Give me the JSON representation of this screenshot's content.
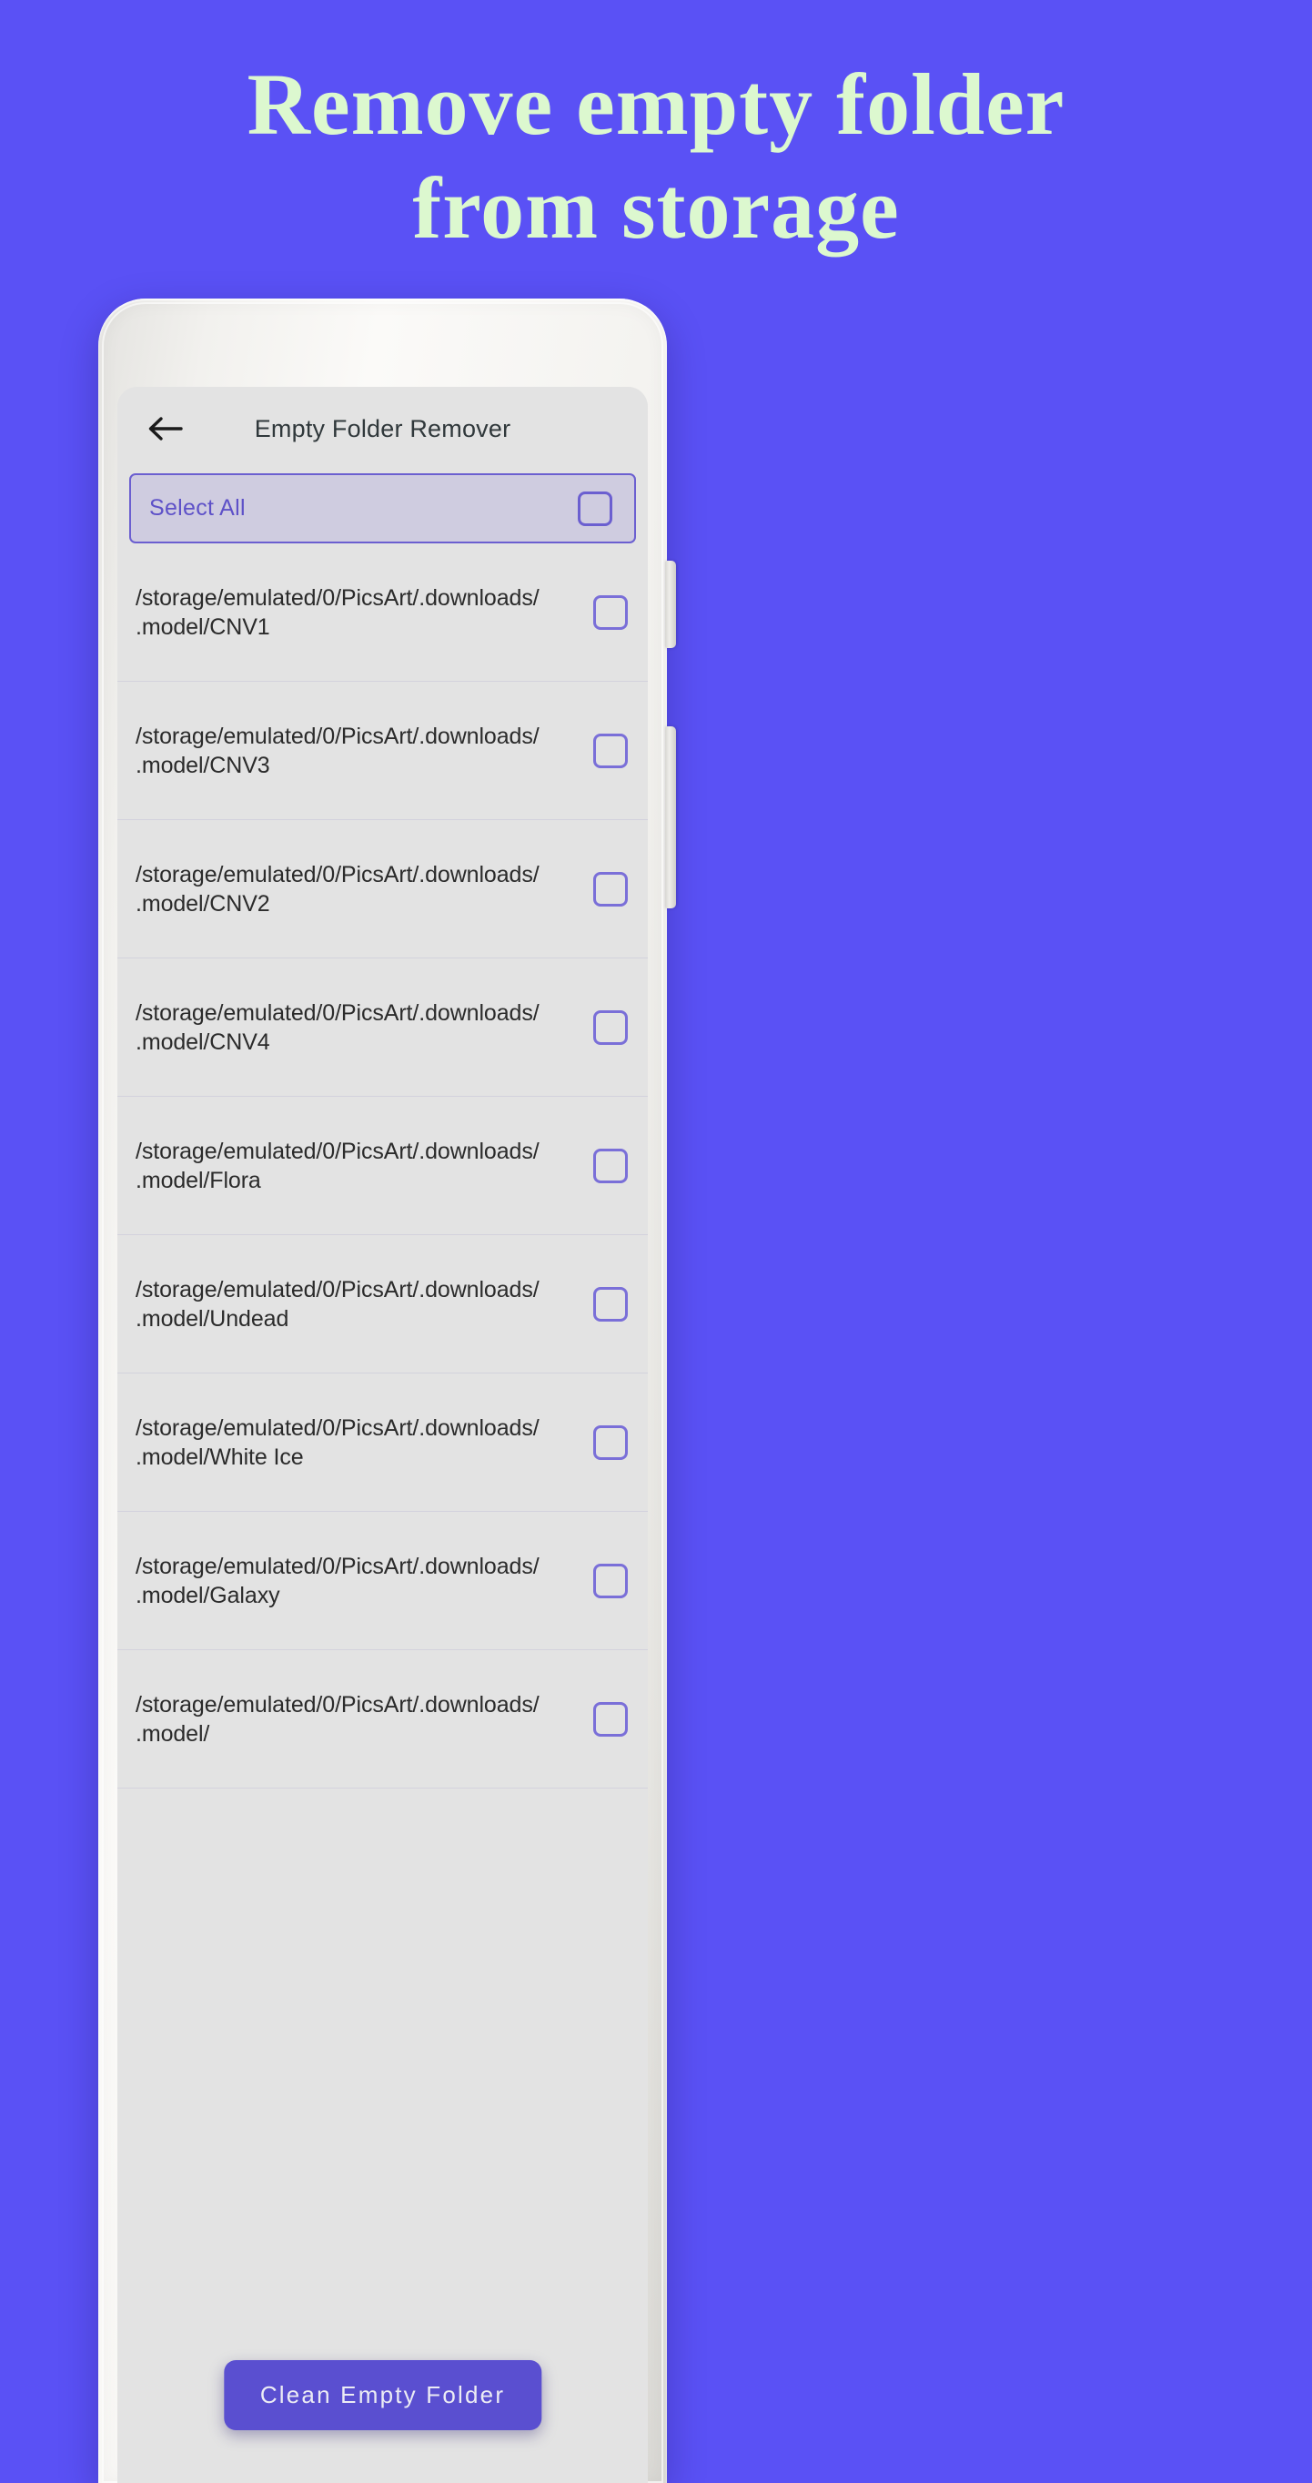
{
  "promo": {
    "line1": "Remove empty folder",
    "line2": "from storage",
    "text_color": "#dcf8cf",
    "background_color": "#5a51f5"
  },
  "app": {
    "back_icon": "arrow-left-icon",
    "title": "Empty Folder Remover",
    "accent_color": "#5a4fd0",
    "screen_background": "#e3e3e3"
  },
  "select_all": {
    "label": "Select All",
    "checked": false,
    "border_color": "#6b5fd0",
    "fill_color": "#cfcce0",
    "text_color": "#5e51c8"
  },
  "folders": [
    {
      "path": "/storage/emulated/0/PicsArt/.downloads/.model/CNV1",
      "checked": false
    },
    {
      "path": "/storage/emulated/0/PicsArt/.downloads/.model/CNV3",
      "checked": false
    },
    {
      "path": "/storage/emulated/0/PicsArt/.downloads/.model/CNV2",
      "checked": false
    },
    {
      "path": "/storage/emulated/0/PicsArt/.downloads/.model/CNV4",
      "checked": false
    },
    {
      "path": "/storage/emulated/0/PicsArt/.downloads/.model/Flora",
      "checked": false
    },
    {
      "path": "/storage/emulated/0/PicsArt/.downloads/.model/Undead",
      "checked": false
    },
    {
      "path": "/storage/emulated/0/PicsArt/.downloads/.model/White Ice",
      "checked": false
    },
    {
      "path": "/storage/emulated/0/PicsArt/.downloads/.model/Galaxy",
      "checked": false
    },
    {
      "path": "/storage/emulated/0/PicsArt/.downloads/.model/",
      "checked": false
    }
  ],
  "clean_button": {
    "label": "Clean Empty Folder",
    "background_color": "#5a4fd0",
    "text_color": "#ececf4"
  },
  "device": {
    "camera_icons": [
      "camera-dot-icon",
      "camera-dot-icon",
      "sensor-dot-icon"
    ],
    "speaker_icon": "speaker-grille-icon",
    "buttons": [
      "volume-rocker",
      "power-button"
    ]
  }
}
